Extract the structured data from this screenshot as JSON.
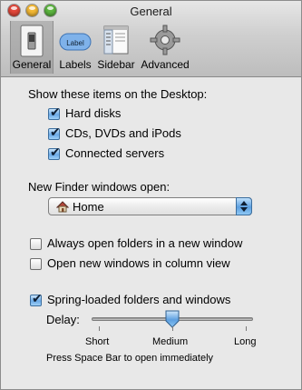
{
  "window": {
    "title": "General"
  },
  "toolbar": {
    "items": [
      {
        "label": "General",
        "icon": "general-switch-icon",
        "selected": true
      },
      {
        "label": "Labels",
        "icon": "labels-icon",
        "badge_text": "Label"
      },
      {
        "label": "Sidebar",
        "icon": "sidebar-icon"
      },
      {
        "label": "Advanced",
        "icon": "gear-icon"
      }
    ]
  },
  "desktop_section": {
    "heading": "Show these items on the Desktop:",
    "options": [
      {
        "label": "Hard disks",
        "checked": true
      },
      {
        "label": "CDs, DVDs and iPods",
        "checked": true
      },
      {
        "label": "Connected servers",
        "checked": true
      }
    ]
  },
  "new_window": {
    "heading": "New Finder windows open:",
    "selected": "Home",
    "icon": "home-icon"
  },
  "folder_options": [
    {
      "label": "Always open folders in a new window",
      "checked": false
    },
    {
      "label": "Open new windows in column view",
      "checked": false
    }
  ],
  "spring": {
    "label": "Spring-loaded folders and windows",
    "checked": true,
    "delay_label": "Delay:",
    "ticks": [
      "Short",
      "Medium",
      "Long"
    ],
    "value": 0.5,
    "hint": "Press Space Bar to open immediately"
  },
  "colors": {
    "accent": "#5c9fe0",
    "check": "#6aa9e6"
  }
}
